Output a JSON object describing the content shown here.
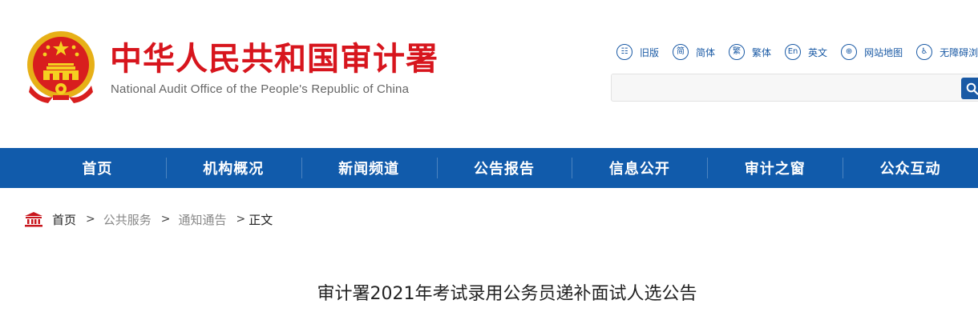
{
  "header": {
    "title": "中华人民共和国审计署",
    "subtitle": "National Audit Office of the People's Republic of China",
    "emblem_icon": "national-emblem-icon",
    "toplinks": [
      {
        "label": "旧版",
        "icon": "old-version-icon",
        "glyph": "☷"
      },
      {
        "label": "简体",
        "icon": "simplified-chinese-icon",
        "glyph": "简"
      },
      {
        "label": "繁体",
        "icon": "traditional-chinese-icon",
        "glyph": "繁"
      },
      {
        "label": "英文",
        "icon": "english-icon",
        "glyph": "En"
      },
      {
        "label": "网站地图",
        "icon": "sitemap-icon",
        "glyph": "⊕"
      },
      {
        "label": "无障碍浏览",
        "icon": "accessibility-icon",
        "glyph": "♿"
      }
    ],
    "search_placeholder": ""
  },
  "nav": {
    "items": [
      "首页",
      "机构概况",
      "新闻频道",
      "公告报告",
      "信息公开",
      "审计之窗",
      "公众互动"
    ]
  },
  "breadcrumb": {
    "home": "首页",
    "sep": ">",
    "level1": "公共服务",
    "level2": "通知通告",
    "current": "正文"
  },
  "article": {
    "title": "审计署2021年考试录用公务员递补面试人选公告"
  },
  "colors": {
    "brand_red": "#d7151d",
    "nav_blue": "#115bab",
    "link_blue": "#1a5aa5",
    "gold": "#f2c21b"
  }
}
